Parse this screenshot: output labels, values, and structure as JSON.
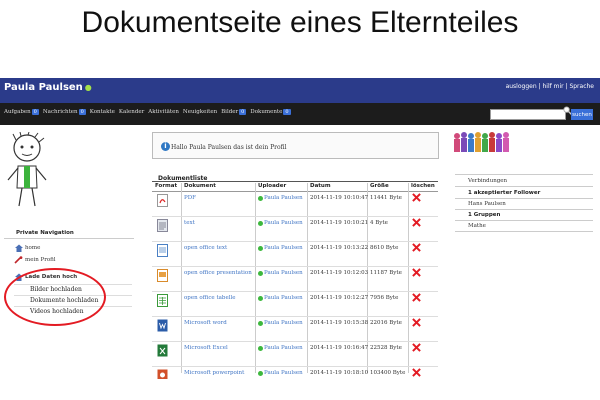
{
  "heading": "Dokumentseite eines Elternteiles",
  "topbar": {
    "user": "Paula Paulsen",
    "links": "ausloggen | hilf mir | Sprache"
  },
  "nav": {
    "items": [
      {
        "label": "Aufgaben",
        "badge": "0"
      },
      {
        "label": "Nachrichten",
        "badge": "0"
      },
      {
        "label": "Kontakte",
        "badge": ""
      },
      {
        "label": "Kalender",
        "badge": ""
      },
      {
        "label": "Aktivitäten",
        "badge": ""
      },
      {
        "label": "Neuigkeiten",
        "badge": ""
      },
      {
        "label": "Bilder",
        "badge": "0"
      },
      {
        "label": "Dokumente",
        "badge": "0"
      }
    ],
    "search_placeholder": "",
    "search_button": "suchen"
  },
  "private_nav": {
    "title": "Private Navigation",
    "home": "home",
    "profile": "mein Profil",
    "upload": "Lade Daten hoch",
    "sub": [
      "Bilder hochladen",
      "Dokumente hochladen",
      "Videos hochladen"
    ]
  },
  "welcome": "Hallo Paula Paulsen das ist dein Profil",
  "documents": {
    "title": "Dokumentliste",
    "columns": [
      "Format",
      "Dokument",
      "Uploader",
      "Datum",
      "Größe",
      "löschen"
    ],
    "rows": [
      {
        "format": "pdf-icon",
        "name": "PDF",
        "uploader": "Paula Paulsen",
        "date": "2014-11-19 10:10:47",
        "size": "11441 Byte"
      },
      {
        "format": "text-icon",
        "name": "text",
        "uploader": "Paula Paulsen",
        "date": "2014-11-19 10:10:21",
        "size": "4 Byte"
      },
      {
        "format": "oo-text-icon",
        "name": "open office text",
        "uploader": "Paula Paulsen",
        "date": "2014-11-19 10:13:22",
        "size": "8610 Byte"
      },
      {
        "format": "oo-presentation-icon",
        "name": "open office presentation",
        "uploader": "Paula Paulsen",
        "date": "2014-11-19 10:12:03",
        "size": "11187 Byte"
      },
      {
        "format": "oo-table-icon",
        "name": "open office tabelle",
        "uploader": "Paula Paulsen",
        "date": "2014-11-19 10:12:27",
        "size": "7956 Byte"
      },
      {
        "format": "word-icon",
        "name": "Microsoft word",
        "uploader": "Paula Paulsen",
        "date": "2014-11-19 10:15:38",
        "size": "22016 Byte"
      },
      {
        "format": "excel-icon",
        "name": "Microsoft Excel",
        "uploader": "Paula Paulsen",
        "date": "2014-11-19 10:16:47",
        "size": "22528 Byte"
      },
      {
        "format": "powerpoint-icon",
        "name": "Microsoft powerpoint",
        "uploader": "Paula Paulsen",
        "date": "2014-11-19 10:18:10",
        "size": "103400 Byte"
      }
    ]
  },
  "connections": {
    "title": "Verbindungen",
    "followers_heading": "1 akzeptierter Follower",
    "follower": "Hans Paulsen",
    "groups_heading": "1 Gruppen",
    "group": "Mathe"
  },
  "colors": {
    "topbar": "#2b3b8a",
    "navbar": "#1c1c1c",
    "link": "#3f74c4",
    "accent": "#e31b23"
  }
}
